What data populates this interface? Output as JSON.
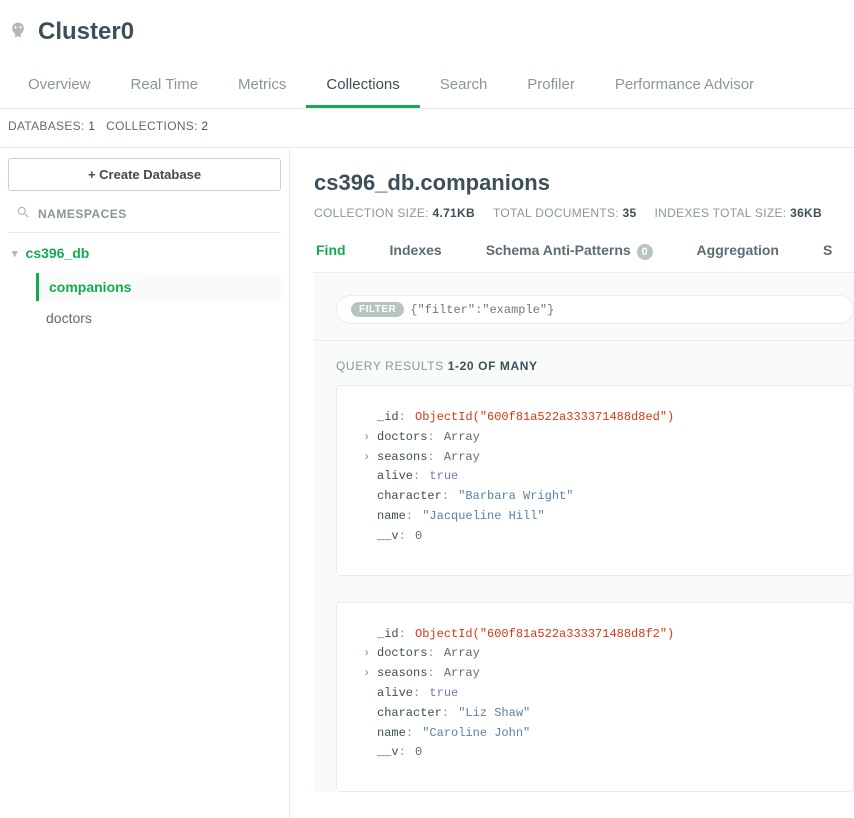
{
  "cluster": {
    "title": "Cluster0"
  },
  "tabs": [
    {
      "label": "Overview"
    },
    {
      "label": "Real Time"
    },
    {
      "label": "Metrics"
    },
    {
      "label": "Collections",
      "active": true
    },
    {
      "label": "Search"
    },
    {
      "label": "Profiler"
    },
    {
      "label": "Performance Advisor"
    }
  ],
  "statsBar": {
    "databasesLabel": "DATABASES:",
    "databasesCount": "1",
    "collectionsLabel": "COLLECTIONS:",
    "collectionsCount": "2"
  },
  "sidebar": {
    "createLabel": "+  Create Database",
    "namespacesLabel": "NAMESPACES",
    "db": {
      "name": "cs396_db"
    },
    "collections": [
      {
        "name": "companions",
        "active": true
      },
      {
        "name": "doctors"
      }
    ]
  },
  "collectionHeader": {
    "title": "cs396_db.companions",
    "sizeLabel": "COLLECTION SIZE:",
    "sizeVal": "4.71KB",
    "docsLabel": "TOTAL DOCUMENTS:",
    "docsVal": "35",
    "idxLabel": "INDEXES TOTAL SIZE:",
    "idxVal": "36KB"
  },
  "subtabs": [
    {
      "label": "Find",
      "active": true
    },
    {
      "label": "Indexes"
    },
    {
      "label": "Schema Anti-Patterns",
      "badge": "0"
    },
    {
      "label": "Aggregation"
    },
    {
      "label": "S"
    }
  ],
  "filter": {
    "badge": "FILTER",
    "placeholder": "{\"filter\":\"example\"}"
  },
  "results": {
    "label": "QUERY RESULTS",
    "range": "1-20 OF MANY"
  },
  "documents": [
    {
      "_id": "ObjectId(\"600f81a522a333371488d8ed\")",
      "doctors": "Array",
      "seasons": "Array",
      "alive": "true",
      "character": "\"Barbara Wright\"",
      "name": "\"Jacqueline Hill\"",
      "__v": "0"
    },
    {
      "_id": "ObjectId(\"600f81a522a333371488d8f2\")",
      "doctors": "Array",
      "seasons": "Array",
      "alive": "true",
      "character": "\"Liz Shaw\"",
      "name": "\"Caroline John\"",
      "__v": "0"
    }
  ]
}
